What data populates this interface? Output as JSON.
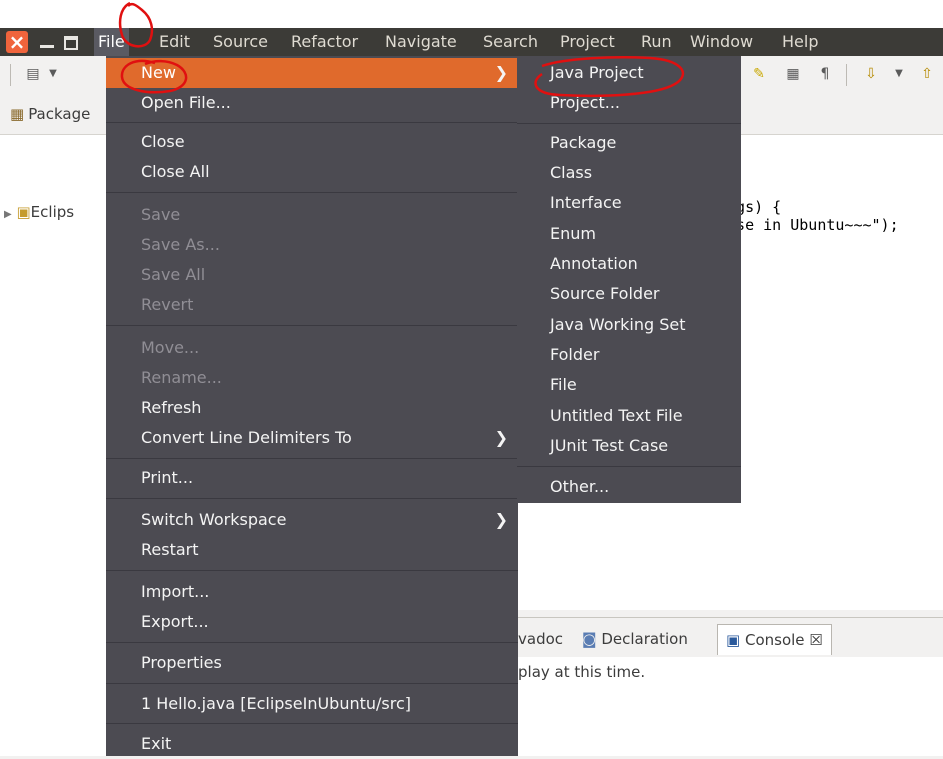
{
  "menubar": {
    "close_glyph": "×",
    "items": [
      "File",
      "Edit",
      "Source",
      "Refactor",
      "Navigate",
      "Search",
      "Project",
      "Run",
      "Window",
      "Help"
    ]
  },
  "views": {
    "package_tab": "Package",
    "tree_item": "Eclips"
  },
  "editor": {
    "code_line1": "args) {",
    "code_line2": "ipse in Ubuntu~~~\");"
  },
  "bottom": {
    "tab_javadoc": "vadoc",
    "tab_declaration": "Declaration",
    "tab_console": "Console",
    "console_close": "☒",
    "message": "play at this time."
  },
  "file_menu": {
    "new": "New",
    "open_file": "Open File...",
    "close": "Close",
    "close_all": "Close All",
    "save": "Save",
    "save_as": "Save As...",
    "save_all": "Save All",
    "revert": "Revert",
    "move": "Move...",
    "rename": "Rename...",
    "refresh": "Refresh",
    "convert": "Convert Line Delimiters To",
    "print": "Print...",
    "switch_workspace": "Switch Workspace",
    "restart": "Restart",
    "import": "Import...",
    "export": "Export...",
    "properties": "Properties",
    "recent": "1 Hello.java  [EclipseInUbuntu/src]",
    "exit": "Exit"
  },
  "new_submenu": {
    "java_project": "Java Project",
    "project": "Project...",
    "package": "Package",
    "class": "Class",
    "interface": "Interface",
    "enum": "Enum",
    "annotation": "Annotation",
    "source_folder": "Source Folder",
    "java_working_set": "Java Working Set",
    "folder": "Folder",
    "file": "File",
    "untitled_text_file": "Untitled Text File",
    "junit_test_case": "JUnit Test Case",
    "other": "Other..."
  },
  "colors": {
    "menubar_bg": "#3c3b37",
    "menu_bg": "#4c4b52",
    "highlight": "#e06a2c",
    "annotation_red": "#e01010"
  },
  "icons": [
    "close-window-icon",
    "minimize-icon",
    "maximize-icon",
    "submenu-arrow-icon",
    "package-explorer-icon",
    "project-icon",
    "declaration-icon",
    "console-icon"
  ]
}
